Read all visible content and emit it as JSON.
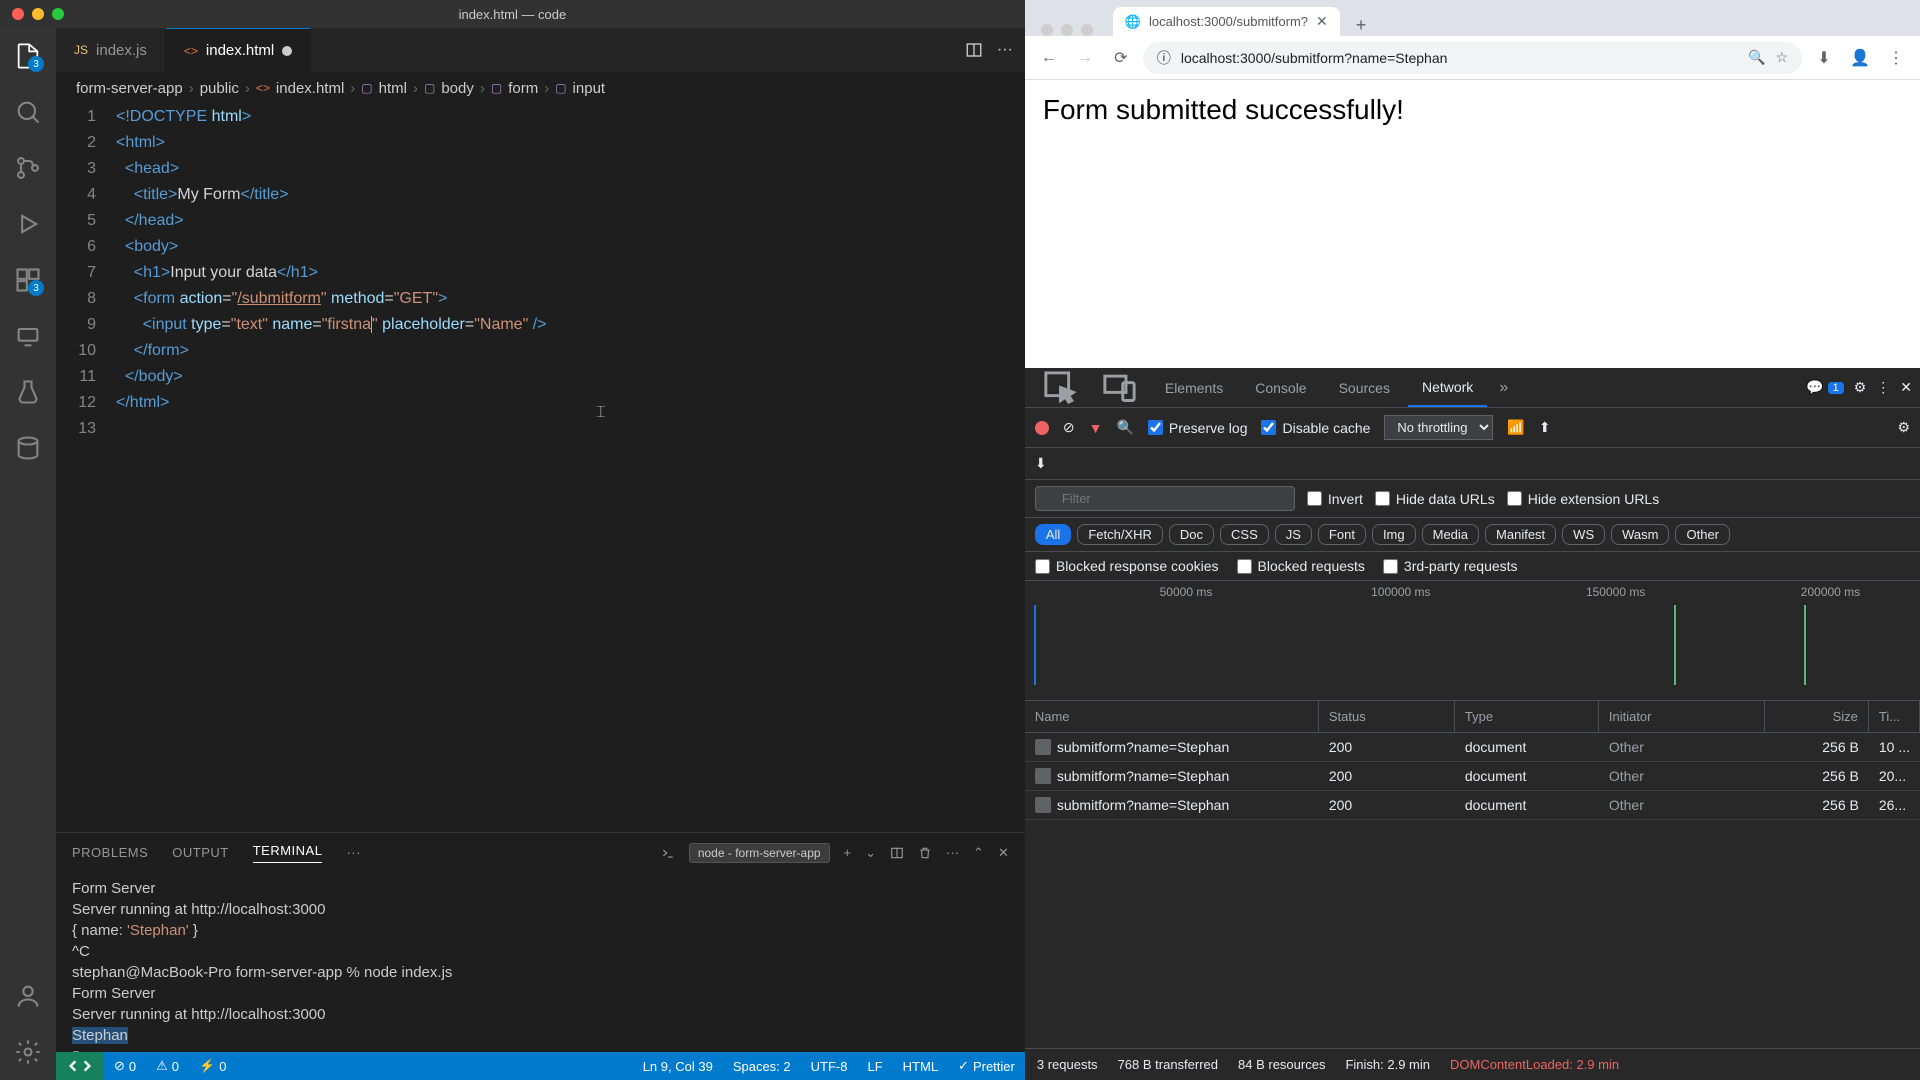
{
  "vscode": {
    "title": "index.html — code",
    "tabs": [
      {
        "icon": "JS",
        "label": "index.js",
        "active": false
      },
      {
        "icon": "<>",
        "label": "index.html",
        "active": true,
        "dirty": true
      }
    ],
    "breadcrumb": [
      "form-server-app",
      "public",
      "index.html",
      "html",
      "body",
      "form",
      "input"
    ],
    "lines": [
      "1",
      "2",
      "3",
      "4",
      "5",
      "6",
      "7",
      "8",
      "9",
      "10",
      "11",
      "12",
      "13"
    ],
    "activity_badge": "3",
    "panel": {
      "tabs": [
        "PROBLEMS",
        "OUTPUT",
        "TERMINAL",
        "···"
      ],
      "active": "TERMINAL",
      "shell": "node - form-server-app"
    },
    "terminal": [
      "Form Server",
      "Server running at http://localhost:3000",
      "{ name: 'Stephan' }",
      "^C",
      "stephan@MacBook-Pro form-server-app % node index.js",
      "Form Server",
      "Server running at http://localhost:3000",
      "Stephan"
    ],
    "status": {
      "errors": "0",
      "warnings": "0",
      "ports": "0",
      "cursor": "Ln 9, Col 39",
      "spaces": "Spaces: 2",
      "encoding": "UTF-8",
      "eol": "LF",
      "lang": "HTML",
      "formatter": "Prettier"
    }
  },
  "browser": {
    "tab_title": "localhost:3000/submitform?",
    "url": "localhost:3000/submitform?name=Stephan",
    "page_text": "Form submitted successfully!"
  },
  "devtools": {
    "tabs": [
      "Elements",
      "Console",
      "Sources",
      "Network"
    ],
    "active_tab": "Network",
    "issues": "1",
    "preserve_log": "Preserve log",
    "disable_cache": "Disable cache",
    "throttling": "No throttling",
    "filter_placeholder": "Filter",
    "filter_checks": [
      "Invert",
      "Hide data URLs",
      "Hide extension URLs"
    ],
    "pills": [
      "All",
      "Fetch/XHR",
      "Doc",
      "CSS",
      "JS",
      "Font",
      "Img",
      "Media",
      "Manifest",
      "WS",
      "Wasm",
      "Other"
    ],
    "bottom_checks": [
      "Blocked response cookies",
      "Blocked requests",
      "3rd-party requests"
    ],
    "timeline_ticks": [
      "50000 ms",
      "100000 ms",
      "150000 ms",
      "200000 ms"
    ],
    "columns": [
      "Name",
      "Status",
      "Type",
      "Initiator",
      "Size",
      "Ti..."
    ],
    "rows": [
      {
        "name": "submitform?name=Stephan",
        "status": "200",
        "type": "document",
        "initiator": "Other",
        "size": "256 B",
        "time": "10 ..."
      },
      {
        "name": "submitform?name=Stephan",
        "status": "200",
        "type": "document",
        "initiator": "Other",
        "size": "256 B",
        "time": "20..."
      },
      {
        "name": "submitform?name=Stephan",
        "status": "200",
        "type": "document",
        "initiator": "Other",
        "size": "256 B",
        "time": "26..."
      }
    ],
    "status": {
      "requests": "3 requests",
      "transferred": "768 B transferred",
      "resources": "84 B resources",
      "finish": "Finish: 2.9 min",
      "domload": "DOMContentLoaded: 2.9 min"
    }
  }
}
